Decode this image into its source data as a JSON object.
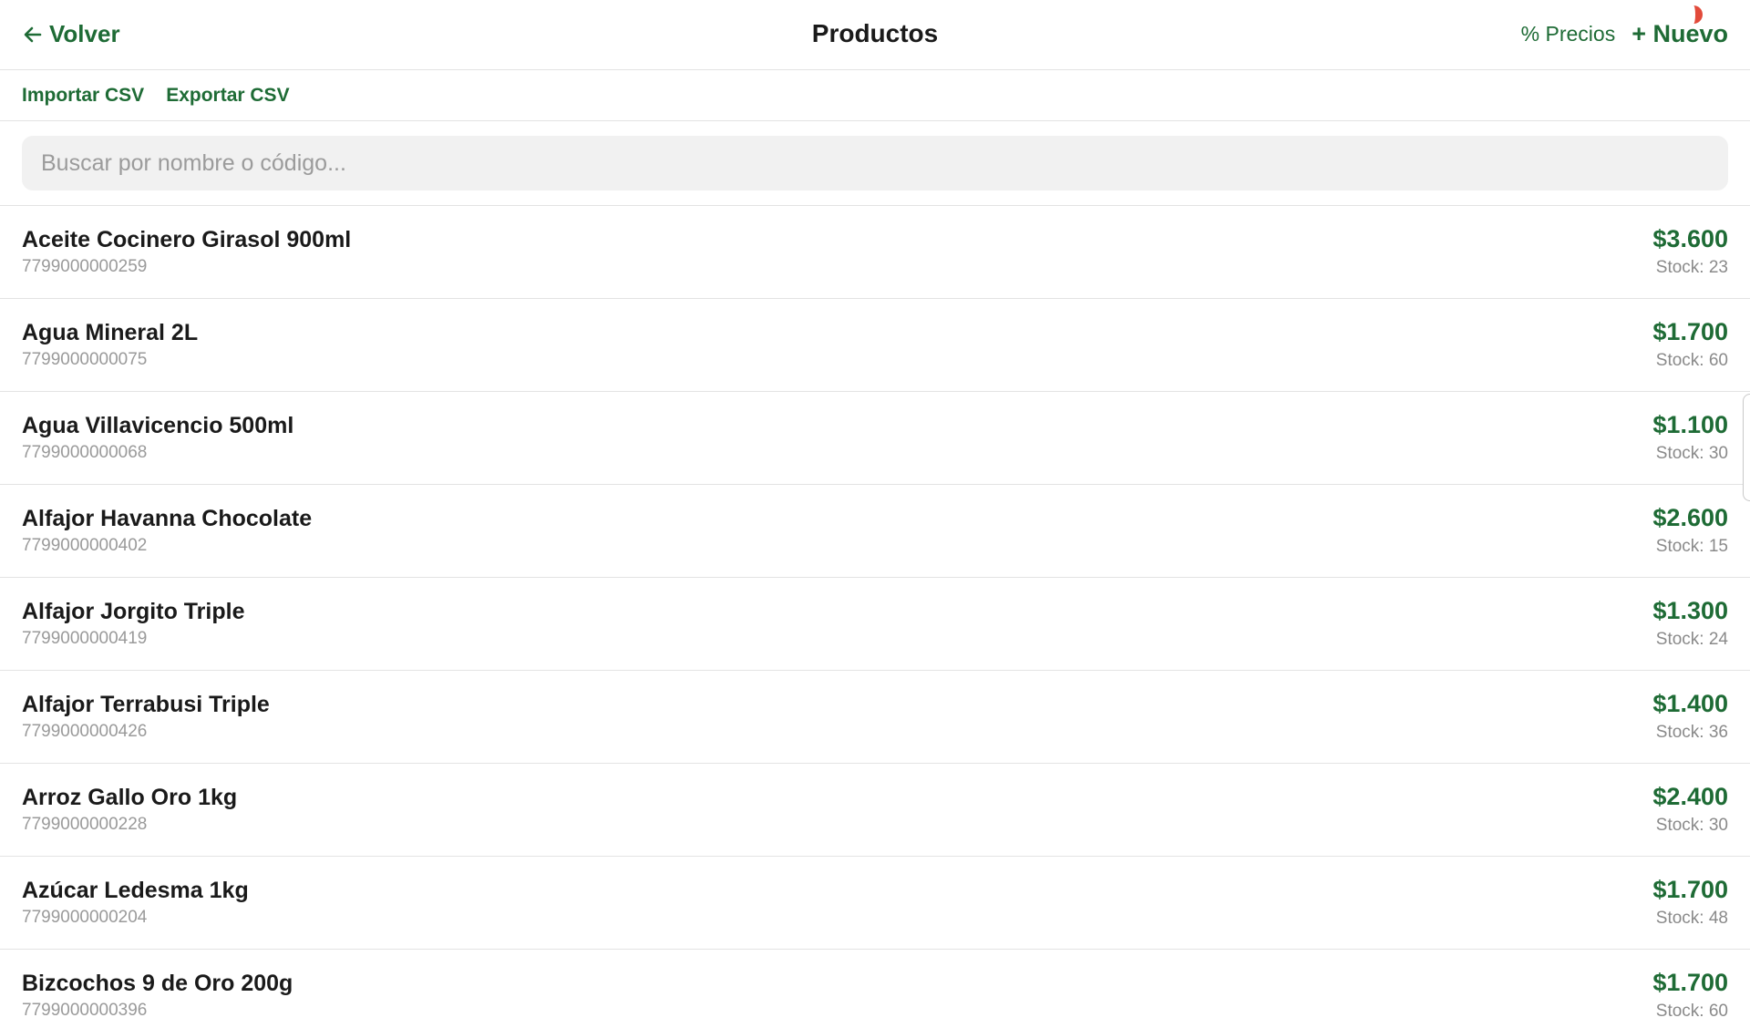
{
  "header": {
    "back_label": "Volver",
    "title": "Productos",
    "precios_label": "% Precios",
    "nuevo_label": "+ Nuevo"
  },
  "toolbar": {
    "import_label": "Importar CSV",
    "export_label": "Exportar CSV"
  },
  "search": {
    "placeholder": "Buscar por nombre o código...",
    "value": ""
  },
  "products": [
    {
      "name": "Aceite Cocinero Girasol 900ml",
      "code": "7799000000259",
      "price": "$3.600",
      "stock": "Stock: 23"
    },
    {
      "name": "Agua Mineral 2L",
      "code": "7799000000075",
      "price": "$1.700",
      "stock": "Stock: 60"
    },
    {
      "name": "Agua Villavicencio 500ml",
      "code": "7799000000068",
      "price": "$1.100",
      "stock": "Stock: 30"
    },
    {
      "name": "Alfajor Havanna Chocolate",
      "code": "7799000000402",
      "price": "$2.600",
      "stock": "Stock: 15"
    },
    {
      "name": "Alfajor Jorgito Triple",
      "code": "7799000000419",
      "price": "$1.300",
      "stock": "Stock: 24"
    },
    {
      "name": "Alfajor Terrabusi Triple",
      "code": "7799000000426",
      "price": "$1.400",
      "stock": "Stock: 36"
    },
    {
      "name": "Arroz Gallo Oro 1kg",
      "code": "7799000000228",
      "price": "$2.400",
      "stock": "Stock: 30"
    },
    {
      "name": "Azúcar Ledesma 1kg",
      "code": "7799000000204",
      "price": "$1.700",
      "stock": "Stock: 48"
    },
    {
      "name": "Bizcochos 9 de Oro 200g",
      "code": "7799000000396",
      "price": "$1.700",
      "stock": "Stock: 60"
    }
  ],
  "colors": {
    "accent": "#1e6b35",
    "divider": "#e3e3e3",
    "search_bg": "#f1f1f1",
    "badge": "#e24a3a"
  },
  "icons": {
    "back": "arrow-left-icon"
  }
}
